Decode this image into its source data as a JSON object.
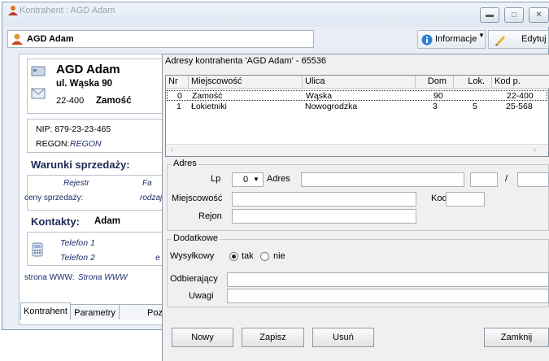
{
  "window": {
    "title": "Kontrahent : AGD Adam"
  },
  "header": {
    "name": "AGD Adam",
    "info_label": "Informacje",
    "edit_label": "Edytuj"
  },
  "left": {
    "company": "AGD Adam",
    "street": "ul. Wąska 90",
    "postal": "22-400",
    "city": "Zamość",
    "nip": "NIP:  879-23-23-465",
    "regon_label": "REGON:",
    "regon_value": "REGON",
    "sales_title": "Warunki sprzedaży:",
    "rejestr": "Rejestr",
    "fa": "Fa",
    "ceny": "ceny sprzedaży:",
    "rodzaj": "rodzaj",
    "contacts_label": "Kontakty:",
    "contacts_value": "Adam",
    "phone1": "Telefon 1",
    "phone2": "Telefon 2",
    "e_trunc": "e",
    "www_label": "strona WWW:",
    "www_value": "Strona WWW",
    "tabs": [
      "Kontrahent",
      "Parametry",
      "Poz"
    ]
  },
  "dialog": {
    "title": "Adresy kontrahenta 'AGD Adam' - 65536",
    "columns": [
      "Nr",
      "Miejscowość",
      "Ulica",
      "Dom",
      "Lok.",
      "Kod p."
    ],
    "rows": [
      {
        "nr": "0",
        "city": "Zamość",
        "street": "Wąska",
        "dom": "90",
        "lok": "",
        "kod": "22-400"
      },
      {
        "nr": "1",
        "city": "Łokietniki",
        "street": "Nowogrodzka",
        "dom": "3",
        "lok": "5",
        "kod": "25-568"
      }
    ],
    "adres_legend": "Adres",
    "lp_label": "Lp",
    "lp_value": "0",
    "adres_label": "Adres",
    "slash": "/",
    "miejscowosc_label": "Miejscowość",
    "kod_label": "Kod",
    "rejon_label": "Rejon",
    "dodatkowe_legend": "Dodatkowe",
    "wysylkowy_label": "Wysyłkowy",
    "tak": "tak",
    "nie": "nie",
    "odbierajacy_label": "Odbierający",
    "uwagi_label": "Uwagi",
    "buttons": {
      "nowy": "Nowy",
      "zapisz": "Zapisz",
      "usun": "Usuń",
      "zamknij": "Zamknij"
    }
  }
}
